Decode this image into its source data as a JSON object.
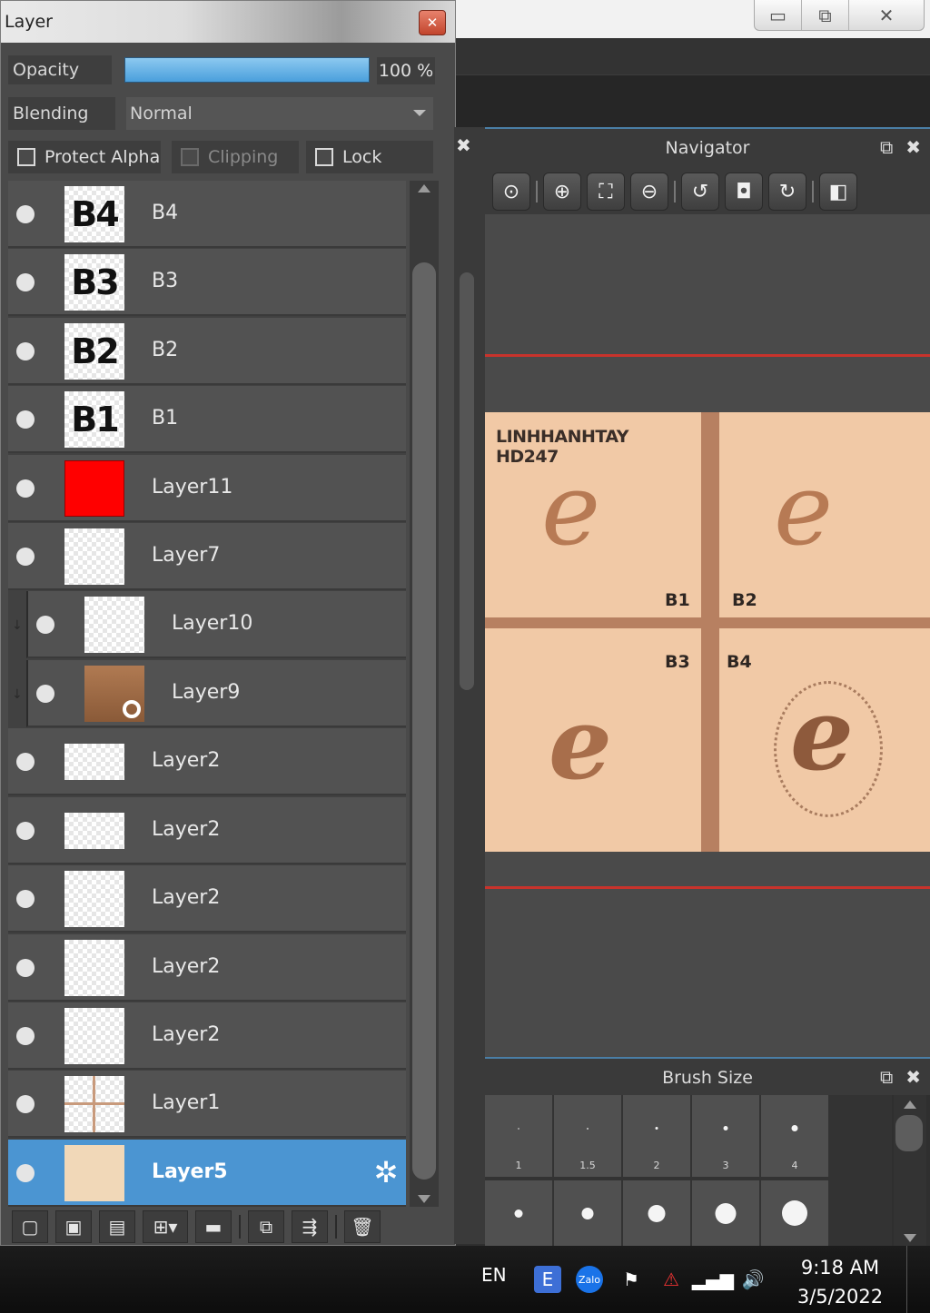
{
  "window_controls": {
    "minimize": "▭",
    "restore": "⧉",
    "close": "✕"
  },
  "layer_panel": {
    "title": "Layer",
    "close_glyph": "✕",
    "opacity_label": "Opacity",
    "opacity_value": "100 %",
    "opacity_fraction": 1.0,
    "blending_label": "Blending",
    "blending_value": "Normal",
    "protect_alpha": "Protect Alpha",
    "clipping": "Clipping",
    "lock": "Lock",
    "layers": [
      {
        "name": "B4",
        "thumb": "B4"
      },
      {
        "name": "B3",
        "thumb": "B3"
      },
      {
        "name": "B2",
        "thumb": "B2"
      },
      {
        "name": "B1",
        "thumb": "B1"
      },
      {
        "name": "Layer11",
        "thumb_color": "#ff0000"
      },
      {
        "name": "Layer7"
      },
      {
        "name": "Layer10",
        "clipped": true
      },
      {
        "name": "Layer9",
        "clipped": true,
        "thumb_color": "#9c6a45"
      },
      {
        "name": "Layer2"
      },
      {
        "name": "Layer2"
      },
      {
        "name": "Layer2"
      },
      {
        "name": "Layer2"
      },
      {
        "name": "Layer2"
      },
      {
        "name": "Layer1"
      },
      {
        "name": "Layer5",
        "selected": true,
        "thumb_color": "#f1d8b8"
      }
    ],
    "toolbar_icons": [
      "new-layer-icon",
      "new-raster-icon",
      "new-page-icon",
      "add-dropdown-icon",
      "folder-icon",
      "duplicate-icon",
      "merge-icon",
      "delete-icon"
    ]
  },
  "navigator": {
    "title": "Navigator",
    "canvas_title_line1": "LINHHANHTAY",
    "canvas_title_line2": "HD247",
    "labels": {
      "b1": "B1",
      "b2": "B2",
      "b3": "B3",
      "b4": "B4"
    },
    "glyph": "e",
    "canvas_color": "#f1c9a6",
    "divider_color": "#b78061"
  },
  "brush_size": {
    "title": "Brush Size",
    "row1": [
      {
        "label": "1"
      },
      {
        "label": "1.5"
      },
      {
        "label": "2"
      },
      {
        "label": "3"
      },
      {
        "label": "4"
      }
    ]
  },
  "taskbar": {
    "language": "EN",
    "time": "9:18 AM",
    "date": "3/5/2022"
  }
}
